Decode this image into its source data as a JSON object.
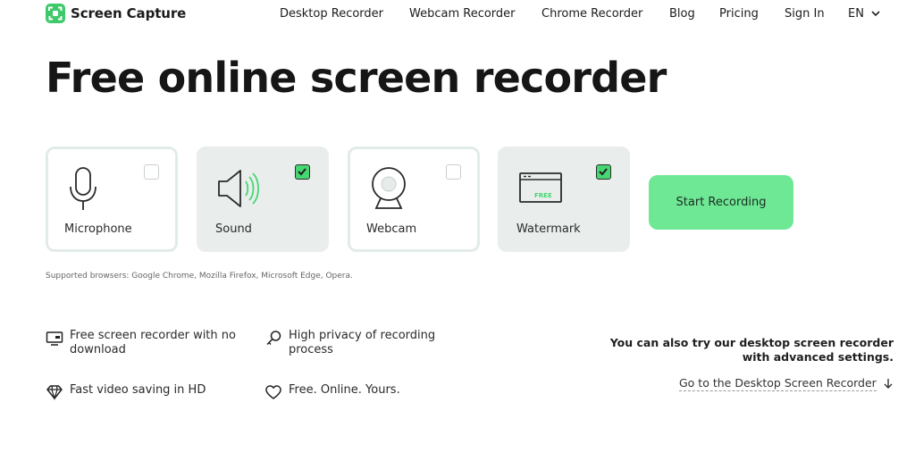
{
  "brand": {
    "name": "Screen Capture",
    "accent": "#3ec96a"
  },
  "nav": {
    "items": [
      "Desktop Recorder",
      "Webcam Recorder",
      "Chrome Recorder",
      "Blog",
      "Pricing",
      "Sign In"
    ],
    "language": "EN"
  },
  "hero": {
    "title": "Free online screen recorder"
  },
  "options": [
    {
      "label": "Microphone",
      "icon": "microphone-icon",
      "checked": false
    },
    {
      "label": "Sound",
      "icon": "speaker-icon",
      "checked": true
    },
    {
      "label": "Webcam",
      "icon": "webcam-icon",
      "checked": false
    },
    {
      "label": "Watermark",
      "icon": "watermark-icon",
      "checked": true,
      "badge": "FREE"
    }
  ],
  "start_button": {
    "label": "Start Recording",
    "color": "#6ee895"
  },
  "supported": "Supported browsers: Google Chrome, Mozilla Firefox, Microsoft Edge, Opera.",
  "features": [
    {
      "text_1": "Free screen recorder with no",
      "text_2": "download",
      "icon": "monitor-icon"
    },
    {
      "text_1": "High privacy of recording",
      "text_2": "process",
      "icon": "key-icon"
    },
    {
      "text_1": "Fast video saving in HD",
      "icon": "diamond-icon"
    },
    {
      "text_1": "Free. Online. Yours.",
      "icon": "heart-icon"
    }
  ],
  "desktop": {
    "note_1": "You can also try our desktop screen recorder",
    "note_2": "with advanced settings.",
    "link": "Go to the Desktop Screen Recorder"
  }
}
